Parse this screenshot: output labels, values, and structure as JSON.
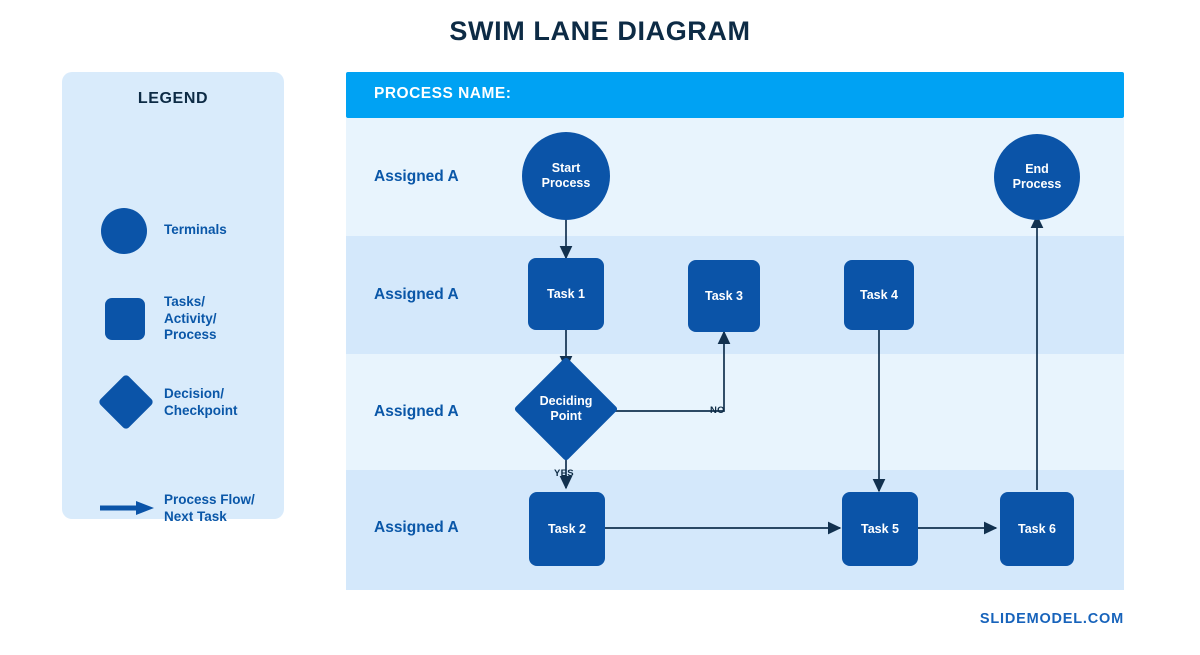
{
  "page": {
    "title": "SWIM LANE DIAGRAM",
    "footer_brand": "SLIDEMODEL.COM"
  },
  "colors": {
    "title": "#0d2b45",
    "node_blue": "#0b54a8",
    "header_blue": "#00a2f3",
    "lane_light": "#e8f4fd",
    "lane_dark": "#d4e8fb",
    "legend_bg": "#d9ebfb",
    "label_blue": "#0a57a8",
    "line": "#12314f",
    "brand": "#1763bb"
  },
  "legend": {
    "title": "LEGEND",
    "items": [
      {
        "glyph": "circle-shape-icon",
        "label": "Terminals"
      },
      {
        "glyph": "rounded-rect-shape-icon",
        "label": "Tasks/\nActivity/\nProcess"
      },
      {
        "glyph": "diamond-shape-icon",
        "label": "Decision/\nCheckpoint"
      },
      {
        "glyph": "arrow-right-icon",
        "label": "Process Flow/\nNext Task"
      }
    ]
  },
  "diagram": {
    "header_label": "PROCESS NAME:",
    "lanes": [
      {
        "label": "Assigned A"
      },
      {
        "label": "Assigned A"
      },
      {
        "label": "Assigned A"
      },
      {
        "label": "Assigned A"
      }
    ],
    "nodes": {
      "start": "Start\nProcess",
      "end": "End\nProcess",
      "task1": "Task 1",
      "task2": "Task 2",
      "task3": "Task 3",
      "task4": "Task 4",
      "task5": "Task 5",
      "task6": "Task 6",
      "decision": "Deciding\nPoint"
    },
    "edge_labels": {
      "no": "NO",
      "yes": "YES"
    }
  }
}
